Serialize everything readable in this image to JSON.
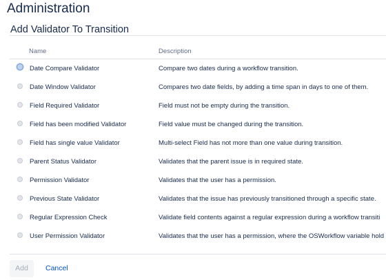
{
  "page": {
    "title": "Administration",
    "section_title": "Add Validator To Transition"
  },
  "table": {
    "headers": {
      "name": "Name",
      "description": "Description"
    },
    "selected_index": 0,
    "rows": [
      {
        "name": "Date Compare Validator",
        "description": "Compare two dates during a workflow transition."
      },
      {
        "name": "Date Window Validator",
        "description": "Compares two date fields, by adding a time span in days to one of them."
      },
      {
        "name": "Field Required Validator",
        "description": "Field must not be empty during the transition."
      },
      {
        "name": "Field has been modified Validator",
        "description": "Field value must be changed during the transition."
      },
      {
        "name": "Field has single value Validator",
        "description": "Multi-select Field has not more than one value during transition."
      },
      {
        "name": "Parent Status Validator",
        "description": "Validates that the parent issue is in required state."
      },
      {
        "name": "Permission Validator",
        "description": "Validates that the user has a permission."
      },
      {
        "name": "Previous State Validator",
        "description": "Validates that the issue has previously transitioned through a specific state."
      },
      {
        "name": "Regular Expression Check",
        "description": "Validate field contents against a regular expression during a workflow transiti"
      },
      {
        "name": "User Permission Validator",
        "description": "Validates that the user has a permission, where the OSWorkflow variable hold"
      }
    ]
  },
  "actions": {
    "add_label": "Add",
    "cancel_label": "Cancel"
  },
  "colors": {
    "text": "#172b4d",
    "muted": "#5e6c84",
    "link": "#0052cc",
    "divider": "#dfe1e6",
    "disabled_button_bg": "#f4f5f7",
    "disabled_button_text": "#a5adba"
  }
}
